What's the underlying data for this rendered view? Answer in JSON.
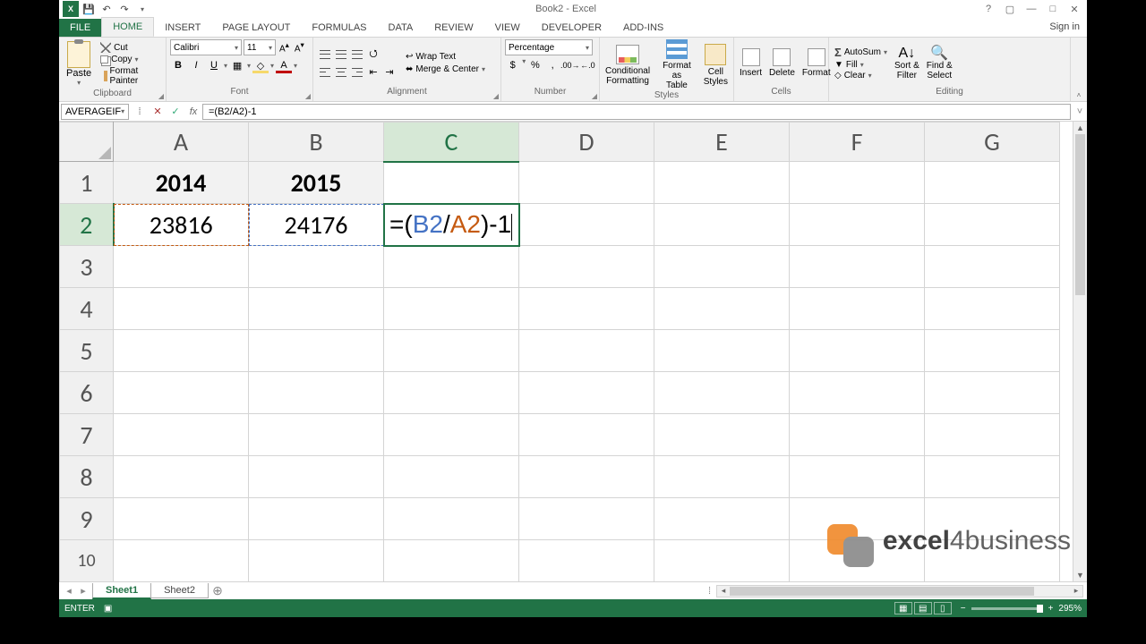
{
  "titlebar": {
    "title": "Book2 - Excel"
  },
  "tabs": {
    "file": "FILE",
    "home": "HOME",
    "insert": "INSERT",
    "pagelayout": "PAGE LAYOUT",
    "formulas": "FORMULAS",
    "data": "DATA",
    "review": "REVIEW",
    "view": "VIEW",
    "developer": "DEVELOPER",
    "addins": "ADD-INS",
    "signin": "Sign in"
  },
  "ribbon": {
    "clipboard": {
      "paste": "Paste",
      "cut": "Cut",
      "copy": "Copy",
      "painter": "Format Painter",
      "label": "Clipboard"
    },
    "font": {
      "name": "Calibri",
      "size": "11",
      "label": "Font"
    },
    "alignment": {
      "wrap": "Wrap Text",
      "merge": "Merge & Center",
      "label": "Alignment"
    },
    "number": {
      "format": "Percentage",
      "label": "Number"
    },
    "styles": {
      "cond": "Conditional\nFormatting",
      "table": "Format as\nTable",
      "cell": "Cell\nStyles",
      "label": "Styles"
    },
    "cells": {
      "insert": "Insert",
      "delete": "Delete",
      "format": "Format",
      "label": "Cells"
    },
    "editing": {
      "autosum": "AutoSum",
      "fill": "Fill",
      "clear": "Clear",
      "sort": "Sort &\nFilter",
      "find": "Find &\nSelect",
      "label": "Editing"
    }
  },
  "formula_bar": {
    "name_box": "AVERAGEIF",
    "formula": "=(B2/A2)-1"
  },
  "grid": {
    "cols": [
      "A",
      "B",
      "C",
      "D",
      "E",
      "F",
      "G"
    ],
    "rows": [
      "1",
      "2",
      "3",
      "4",
      "5",
      "6",
      "7",
      "8",
      "9",
      "10"
    ],
    "data": {
      "A1": "2014",
      "B1": "2015",
      "A2": "23816",
      "B2": "24176"
    },
    "edit_cell": "C2",
    "edit_parts": {
      "pre": "=(",
      "ref_b": "B2",
      "mid1": "/",
      "ref_a": "A2",
      "mid2": ")-1"
    }
  },
  "sheets": {
    "s1": "Sheet1",
    "s2": "Sheet2"
  },
  "status": {
    "mode": "ENTER",
    "zoom": "295%"
  },
  "watermark": {
    "brand_bold": "excel",
    "brand_rest": "4business"
  },
  "chart_data": {
    "type": "table",
    "title": "",
    "columns": [
      "2014",
      "2015"
    ],
    "rows": [
      [
        23816,
        24176
      ]
    ],
    "derived_formula": "=(B2/A2)-1"
  }
}
